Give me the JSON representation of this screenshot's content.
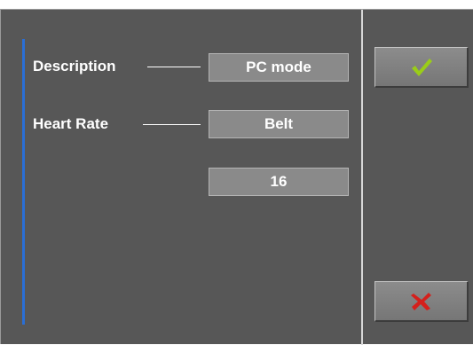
{
  "settings": {
    "rows": [
      {
        "label": "Description",
        "value": "PC mode"
      },
      {
        "label": "Heart Rate",
        "value": "Belt"
      },
      {
        "label": "",
        "value": "16"
      }
    ]
  },
  "actions": {
    "confirm_icon": "checkmark-icon",
    "cancel_icon": "x-icon"
  },
  "colors": {
    "panel_background": "#575757",
    "accent_bar": "#2a6fd6",
    "confirm": "#9acd18",
    "cancel": "#d4201c"
  }
}
